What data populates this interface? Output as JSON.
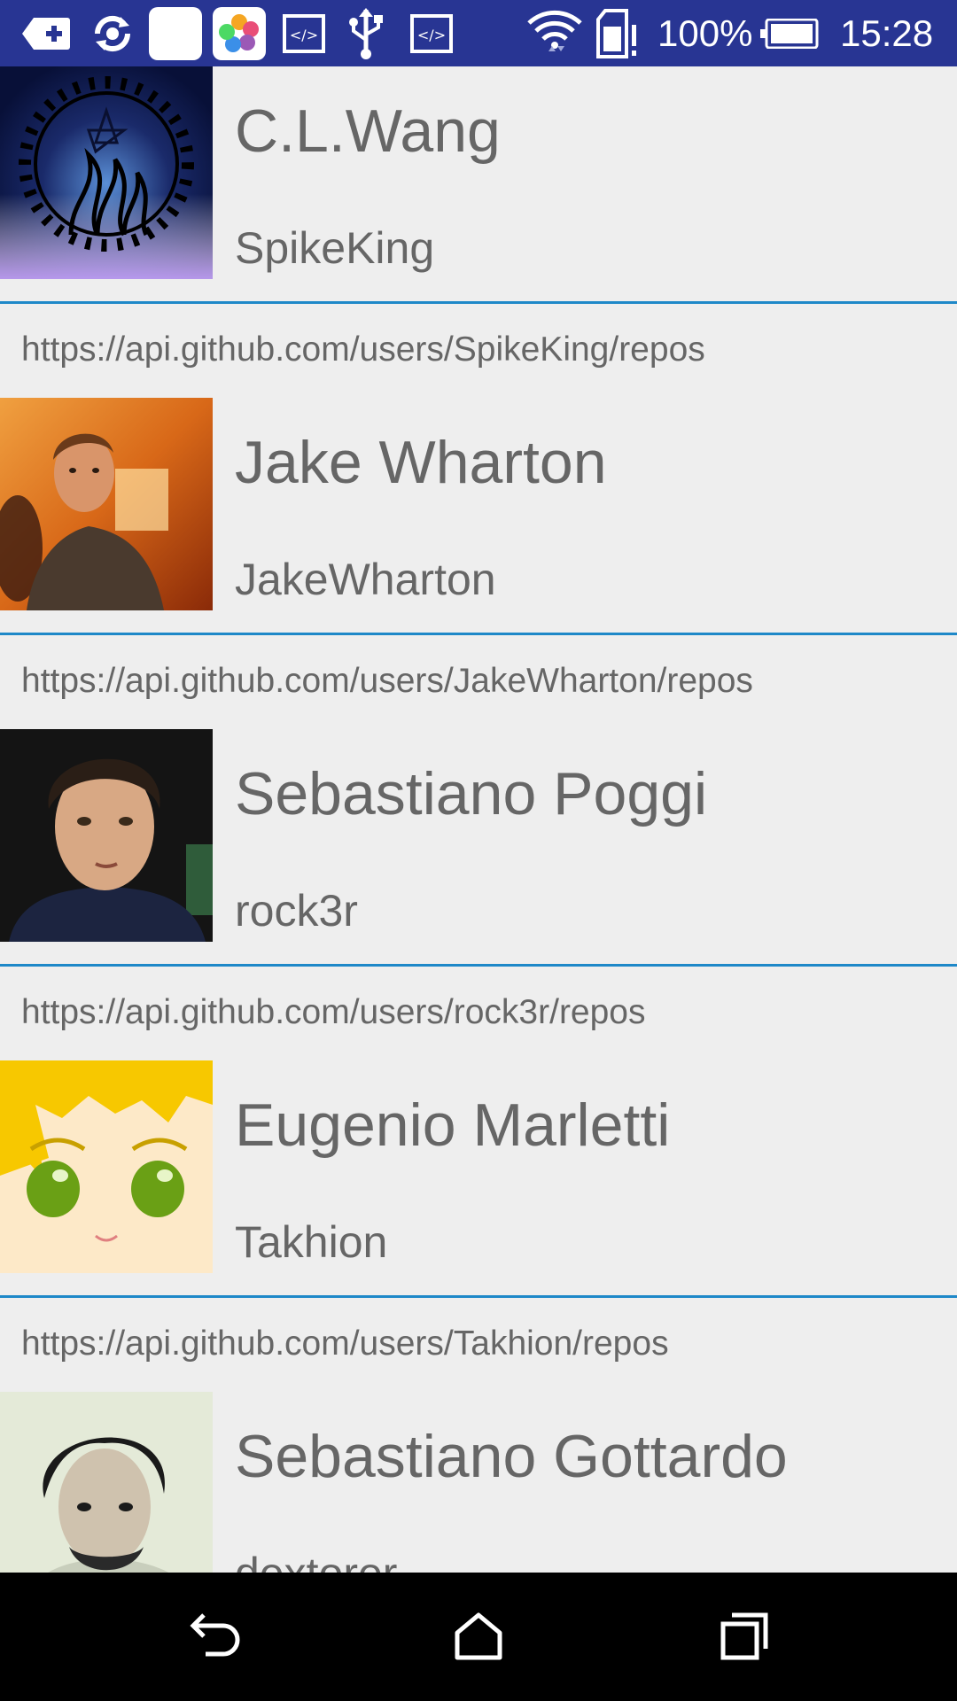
{
  "status_bar": {
    "battery_percent": "100%",
    "time": "15:28",
    "icons": [
      "add-tab-icon",
      "sync-icon",
      "blank-app-icon",
      "photos-app-icon",
      "dev-code-icon",
      "usb-icon",
      "dev-code-icon",
      "wifi-icon",
      "sd-card-alert-icon",
      "battery-icon"
    ]
  },
  "users": [
    {
      "name": "C.L.Wang",
      "login": "SpikeKing",
      "repos_url": "https://api.github.com/users/SpikeKing/repos"
    },
    {
      "name": "Jake Wharton",
      "login": "JakeWharton",
      "repos_url": "https://api.github.com/users/JakeWharton/repos"
    },
    {
      "name": "Sebastiano Poggi",
      "login": "rock3r",
      "repos_url": "https://api.github.com/users/rock3r/repos"
    },
    {
      "name": "Eugenio Marletti",
      "login": "Takhion",
      "repos_url": "https://api.github.com/users/Takhion/repos"
    },
    {
      "name": "Sebastiano Gottardo",
      "login": "dextorer",
      "repos_url": ""
    }
  ],
  "colors": {
    "status_bar": "#283593",
    "divider": "#1e88c8",
    "text": "#666666",
    "background": "#eeeeee"
  },
  "nav_bar": {
    "icons": [
      "back-icon",
      "home-icon",
      "recents-icon"
    ]
  }
}
